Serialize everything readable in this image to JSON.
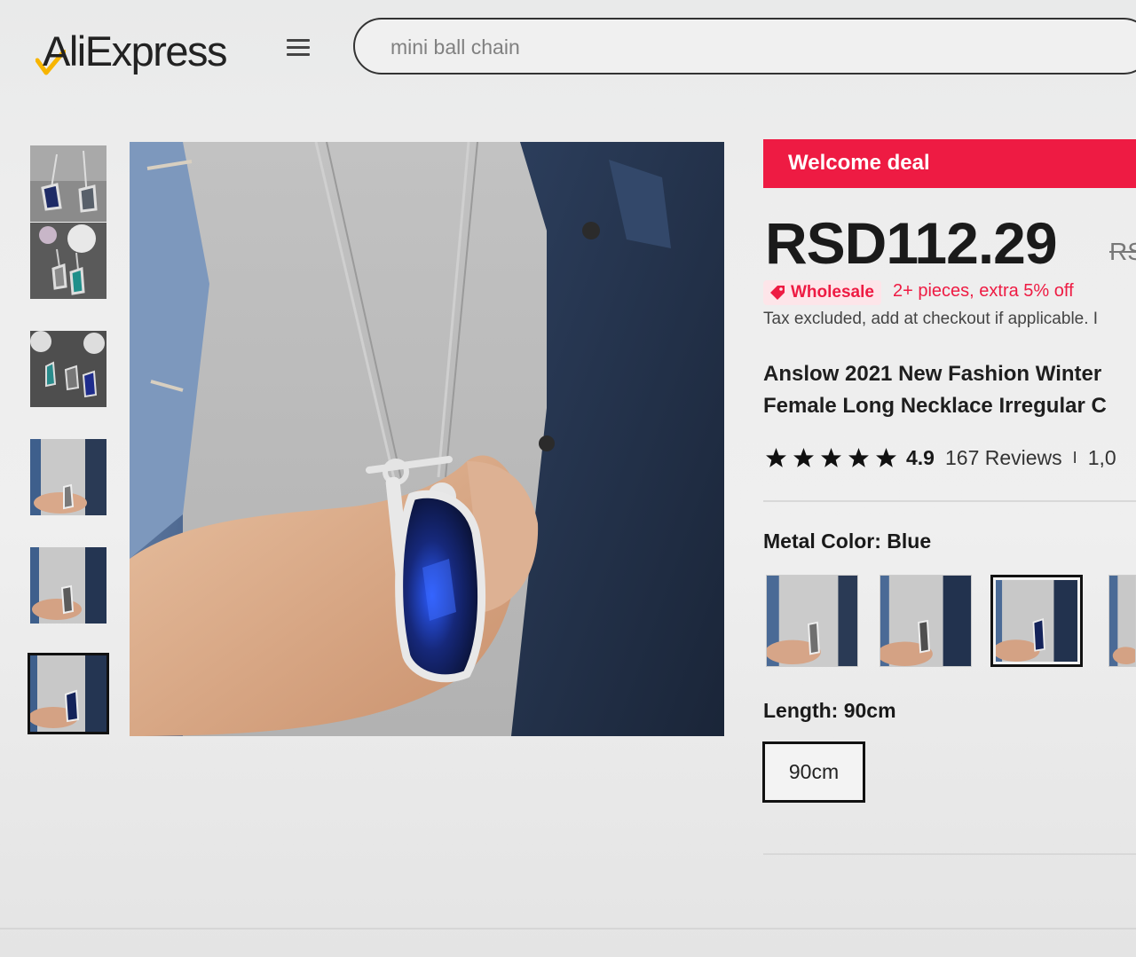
{
  "header": {
    "logo_text": "AliExpress",
    "search_placeholder": "mini ball chain"
  },
  "gallery": {
    "thumbnails": [
      {
        "name": "thumb-1"
      },
      {
        "name": "thumb-2"
      },
      {
        "name": "thumb-3"
      },
      {
        "name": "thumb-4"
      },
      {
        "name": "thumb-5"
      },
      {
        "name": "thumb-6",
        "active": true
      }
    ]
  },
  "product": {
    "deal_label": "Welcome deal",
    "price": "RSD112.29",
    "price_original_prefix": "RS",
    "wholesale_label": "Wholesale",
    "wholesale_offer": "2+ pieces, extra 5% off",
    "tax_note": "Tax excluded, add at checkout if applicable. I",
    "title_line1": "Anslow 2021 New Fashion Winter",
    "title_line2": "Female Long Necklace Irregular C",
    "rating": {
      "stars": 5,
      "value": "4.9",
      "reviews": "167 Reviews",
      "separator": "I",
      "sold_partial": "1,0"
    },
    "metal_color_label": "Metal Color: Blue",
    "length_label": "Length: 90cm",
    "length_option": "90cm"
  },
  "colors": {
    "accent_red": "#ee1b43",
    "badge_bg": "#fde5e9",
    "text_dark": "#1a1a1a",
    "logo_gold": "#f7b500"
  }
}
